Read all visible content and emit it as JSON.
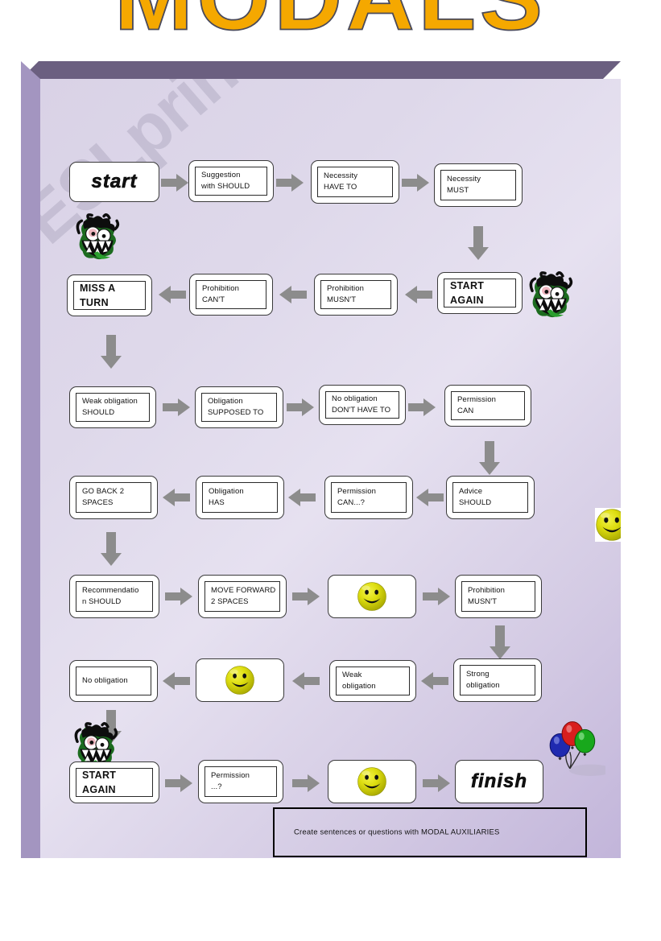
{
  "title": "MODALS",
  "watermark": "ESLprintables.com",
  "caption": "Create sentences or questions with MODAL AUXILIARIES",
  "labels": {
    "start": "start",
    "finish": "finish"
  },
  "board": {
    "row1": [
      {
        "id": "start",
        "kind": "wordart",
        "line1": "start",
        "line2": ""
      },
      {
        "id": "suggestion",
        "kind": "text",
        "line1": "Suggestion",
        "line2": "with SHOULD"
      },
      {
        "id": "necessity-haveto",
        "kind": "text",
        "line1": "Necessity",
        "line2": "HAVE TO"
      },
      {
        "id": "necessity-must",
        "kind": "text",
        "line1": "Necessity",
        "line2": "MUST"
      }
    ],
    "row2": [
      {
        "id": "miss-a-turn",
        "kind": "big",
        "line1": "MISS A",
        "line2": "TURN"
      },
      {
        "id": "prohibition-cant",
        "kind": "text",
        "line1": "Prohibition",
        "line2": "CAN'T"
      },
      {
        "id": "prohibition-musnt",
        "kind": "text",
        "line1": "Prohibition",
        "line2": "MUSN'T"
      },
      {
        "id": "start-again-1",
        "kind": "big",
        "line1": "START",
        "line2": "AGAIN"
      }
    ],
    "row3": [
      {
        "id": "weak-obligation-should",
        "kind": "text",
        "line1": "Weak obligation",
        "line2": "SHOULD"
      },
      {
        "id": "obligation-supposed-to",
        "kind": "text",
        "line1": "Obligation",
        "line2": "SUPPOSED TO"
      },
      {
        "id": "no-obligation-dont-have-to",
        "kind": "text",
        "line1": "No obligation",
        "line2": "DON'T HAVE TO"
      },
      {
        "id": "permission-can",
        "kind": "text",
        "line1": "Permission",
        "line2": "CAN"
      }
    ],
    "row4": [
      {
        "id": "go-back-2-spaces",
        "kind": "text",
        "line1": "GO BACK 2",
        "line2": "SPACES"
      },
      {
        "id": "obligation-has",
        "kind": "text",
        "line1": "Obligation",
        "line2": "HAS"
      },
      {
        "id": "permission-can-q",
        "kind": "text",
        "line1": "Permission",
        "line2": "CAN...?"
      },
      {
        "id": "advice-should",
        "kind": "text",
        "line1": "Advice",
        "line2": "SHOULD"
      }
    ],
    "row5": [
      {
        "id": "recommendation-should",
        "kind": "text",
        "line1": "Recommendatio",
        "line2": "n    SHOULD"
      },
      {
        "id": "move-forward-2-spaces",
        "kind": "text",
        "line1": "MOVE FORWARD",
        "line2": "2 SPACES"
      },
      {
        "id": "smiley-cell-1",
        "kind": "smiley",
        "line1": "",
        "line2": ""
      },
      {
        "id": "prohibition-musnt-2",
        "kind": "text",
        "line1": "Prohibition",
        "line2": "MUSN'T"
      }
    ],
    "row6": [
      {
        "id": "no-obligation",
        "kind": "text",
        "line1": "No obligation",
        "line2": ""
      },
      {
        "id": "smiley-cell-2",
        "kind": "smiley",
        "line1": "",
        "line2": ""
      },
      {
        "id": "weak-obligation",
        "kind": "text",
        "line1": "Weak",
        "line2": "obligation"
      },
      {
        "id": "strong-obligation",
        "kind": "text",
        "line1": "Strong",
        "line2": "obligation"
      }
    ],
    "row7": [
      {
        "id": "start-again-2",
        "kind": "big",
        "line1": "START",
        "line2": "AGAIN"
      },
      {
        "id": "permission-q",
        "kind": "text",
        "line1": "Permission",
        "line2": "...?"
      },
      {
        "id": "smiley-cell-3",
        "kind": "smiley",
        "line1": "",
        "line2": ""
      },
      {
        "id": "finish",
        "kind": "wordart",
        "line1": "finish",
        "line2": ""
      }
    ]
  },
  "decorations": [
    {
      "id": "monster-1",
      "icon": "monster-face-icon"
    },
    {
      "id": "monster-2",
      "icon": "monster-face-icon"
    },
    {
      "id": "monster-3",
      "icon": "monster-face-icon"
    },
    {
      "id": "smiley-side",
      "icon": "smiley-face-icon"
    },
    {
      "id": "balloons",
      "icon": "balloons-icon"
    }
  ],
  "colors": {
    "title_gold": "#f5a800",
    "arrow_gray": "#8c8c8c",
    "page_purple": "#ded8ea",
    "bevel_dark": "#6b5f80",
    "bevel_light": "#a395c0",
    "smiley_yellow": "#d9d900",
    "balloon_red": "#d81e1e",
    "balloon_blue": "#1f2ab0",
    "balloon_green": "#18a81c"
  }
}
